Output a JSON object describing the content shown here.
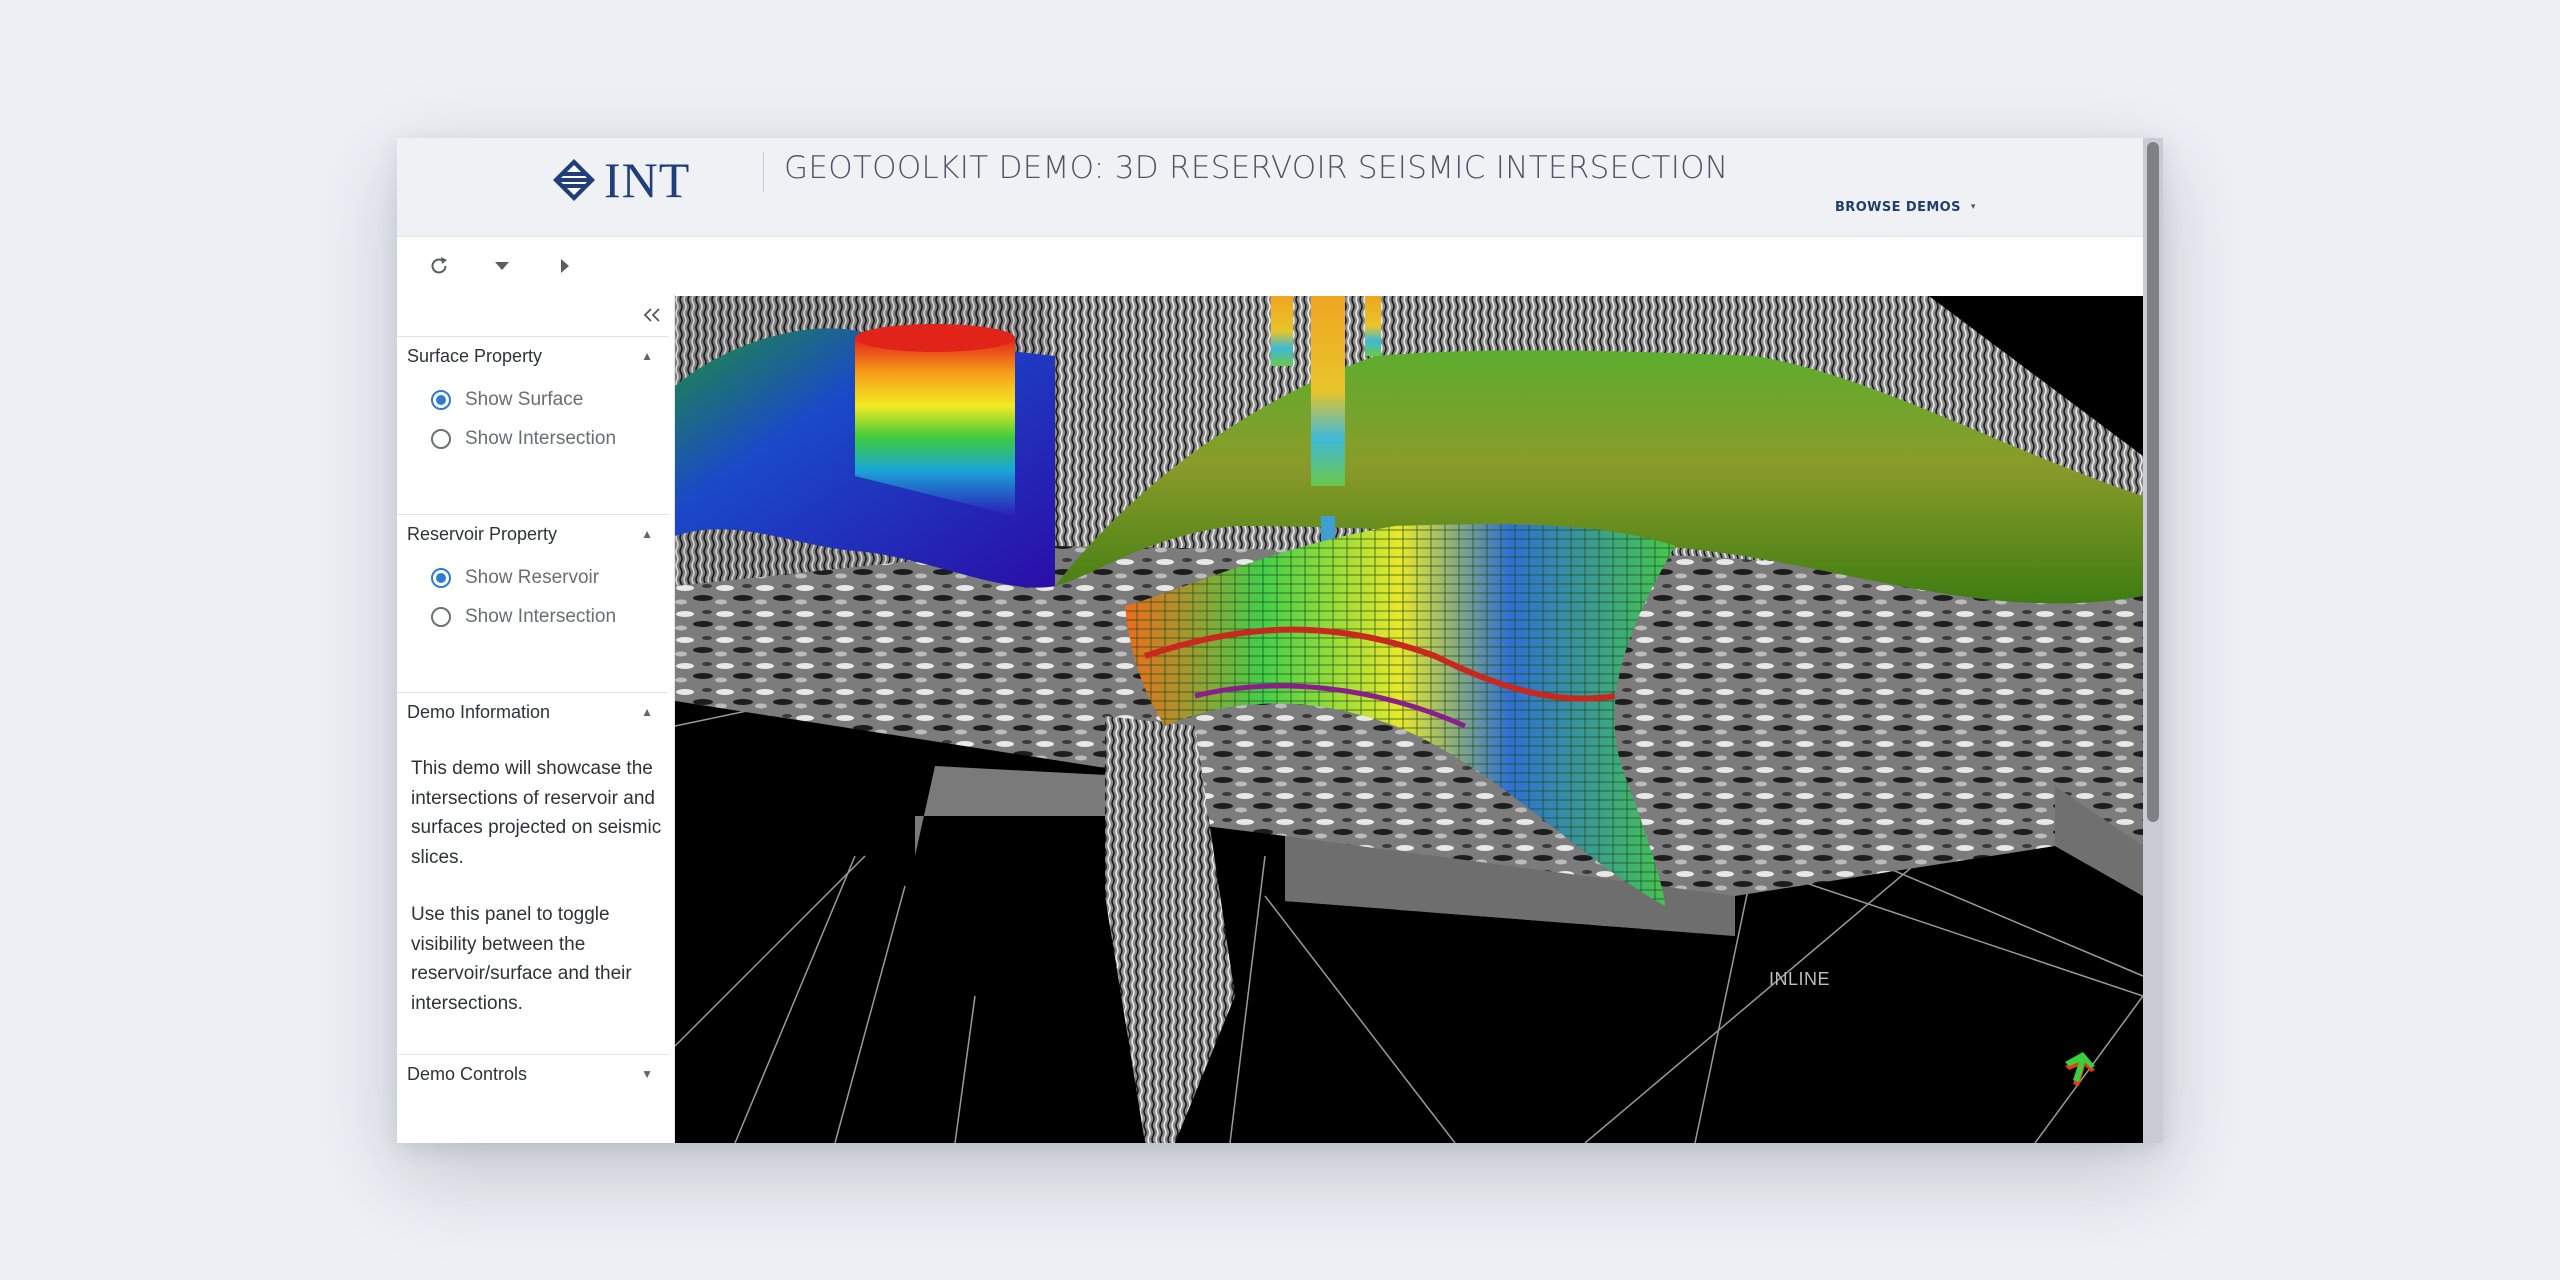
{
  "header": {
    "logo_text": "INT",
    "title": "GEOTOOLKIT DEMO: 3D RESERVOIR SEISMIC INTERSECTION",
    "browse_label": "BROWSE DEMOS",
    "browse_caret": "▾"
  },
  "toolbar": {
    "refresh_icon": "refresh-icon",
    "dropdown_icon": "caret-down-icon",
    "play_icon": "caret-right-icon"
  },
  "sidebar": {
    "collapse_icon": "double-chevron-left-icon",
    "surface": {
      "title": "Surface Property",
      "options": [
        "Show Surface",
        "Show Intersection"
      ],
      "selected": "Show Surface"
    },
    "reservoir": {
      "title": "Reservoir Property",
      "options": [
        "Show Reservoir",
        "Show Intersection"
      ],
      "selected": "Show Reservoir"
    },
    "info": {
      "title": "Demo Information",
      "paragraph1": "This demo will showcase the intersections of reservoir and surfaces projected on seismic slices.",
      "paragraph2": "Use this panel to toggle visibility between the reservoir/surface and their intersections."
    },
    "controls": {
      "title": "Demo Controls"
    }
  },
  "viewport": {
    "axis_label": "INLINE",
    "orientation_icon": "axis-orientation-icon"
  },
  "colors": {
    "brand": "#1f3e7a",
    "radio_accent": "#2e7bd1",
    "background": "#edf0f5"
  }
}
